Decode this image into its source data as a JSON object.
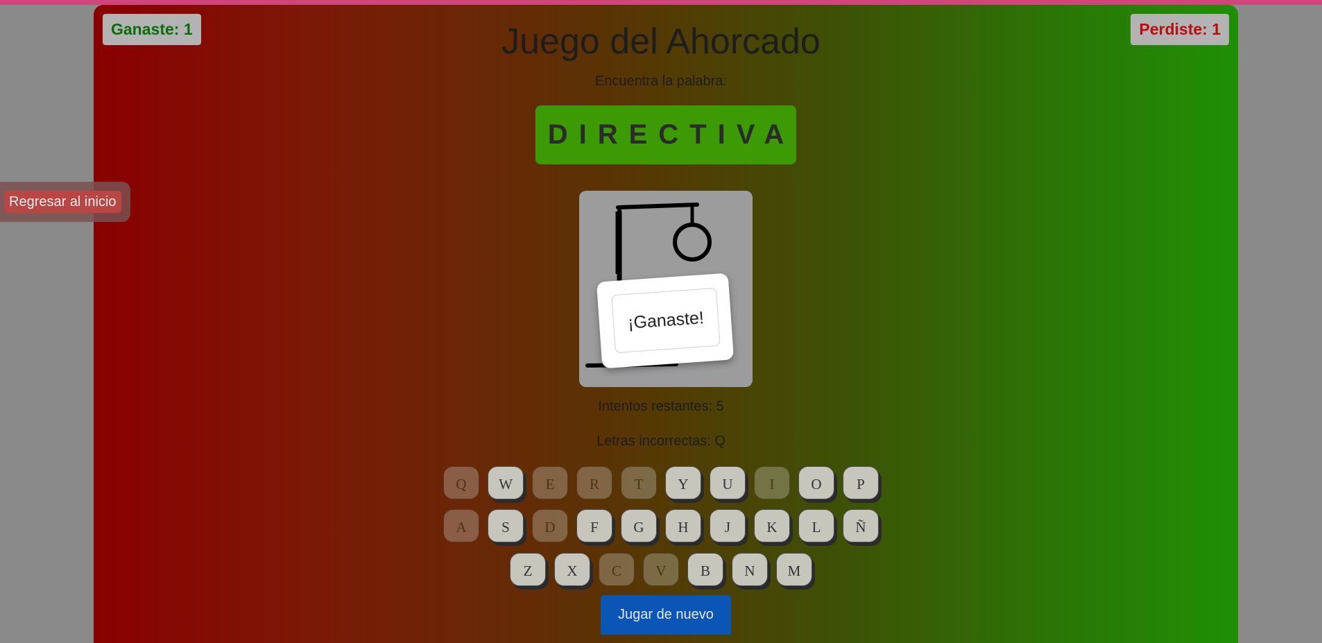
{
  "score": {
    "wins": "Ganaste: 1",
    "losses": "Perdiste: 1"
  },
  "nav": {
    "back_label": "Regresar al inicio"
  },
  "game": {
    "title": "Juego del Ahorcado",
    "subtitle": "Encuentra la palabra:",
    "word": "DIRECTIVA",
    "result": "¡Ganaste!",
    "attempts_text": "Intentos restantes: 5",
    "wrong_letters_text": "Letras incorrectas: Q",
    "play_again_label": "Jugar de nuevo"
  },
  "keyboard": {
    "rows": [
      [
        {
          "l": "Q",
          "used": true
        },
        {
          "l": "W",
          "used": false
        },
        {
          "l": "E",
          "used": true
        },
        {
          "l": "R",
          "used": true
        },
        {
          "l": "T",
          "used": true
        },
        {
          "l": "Y",
          "used": false
        },
        {
          "l": "U",
          "used": false
        },
        {
          "l": "I",
          "used": true
        },
        {
          "l": "O",
          "used": false
        },
        {
          "l": "P",
          "used": false
        }
      ],
      [
        {
          "l": "A",
          "used": true
        },
        {
          "l": "S",
          "used": false
        },
        {
          "l": "D",
          "used": true
        },
        {
          "l": "F",
          "used": false
        },
        {
          "l": "G",
          "used": false
        },
        {
          "l": "H",
          "used": false
        },
        {
          "l": "J",
          "used": false
        },
        {
          "l": "K",
          "used": false
        },
        {
          "l": "L",
          "used": false
        },
        {
          "l": "Ñ",
          "used": false
        }
      ],
      [
        {
          "l": "Z",
          "used": false
        },
        {
          "l": "X",
          "used": false
        },
        {
          "l": "C",
          "used": true
        },
        {
          "l": "V",
          "used": true
        },
        {
          "l": "B",
          "used": false
        },
        {
          "l": "N",
          "used": false
        },
        {
          "l": "M",
          "used": false
        }
      ]
    ]
  },
  "colors": {
    "win": "#0a6d0a",
    "loss": "#b80d0d",
    "word_box": "#3c9a05",
    "play_button": "#0a55b5"
  }
}
